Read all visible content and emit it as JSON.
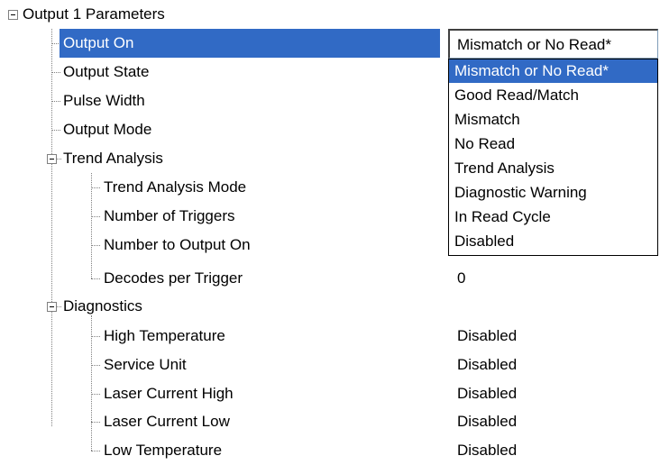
{
  "tree": {
    "root": {
      "label": "Output 1 Parameters"
    },
    "output_on": {
      "label": "Output On"
    },
    "output_state": {
      "label": "Output State"
    },
    "pulse_width": {
      "label": "Pulse Width"
    },
    "output_mode": {
      "label": "Output Mode"
    },
    "trend_analysis": {
      "label": "Trend Analysis",
      "mode": {
        "label": "Trend Analysis Mode"
      },
      "triggers": {
        "label": "Number of Triggers"
      },
      "output_on": {
        "label": "Number to Output On"
      },
      "decodes": {
        "label": "Decodes per Trigger",
        "value": "0"
      }
    },
    "diagnostics": {
      "label": "Diagnostics",
      "items": [
        {
          "label": "High Temperature",
          "value": "Disabled"
        },
        {
          "label": "Service Unit",
          "value": "Disabled"
        },
        {
          "label": "Laser Current High",
          "value": "Disabled"
        },
        {
          "label": "Laser Current Low",
          "value": "Disabled"
        },
        {
          "label": "Low Temperature",
          "value": "Disabled"
        }
      ]
    }
  },
  "combo": {
    "value": "Mismatch or No Read*"
  },
  "dropdown": {
    "options": [
      "Mismatch or No Read*",
      "Good Read/Match",
      "Mismatch",
      "No Read",
      "Trend Analysis",
      "Diagnostic Warning",
      "In Read Cycle",
      "Disabled"
    ]
  },
  "colors": {
    "selection": "#316ac5",
    "tree_lines": "#808080"
  }
}
